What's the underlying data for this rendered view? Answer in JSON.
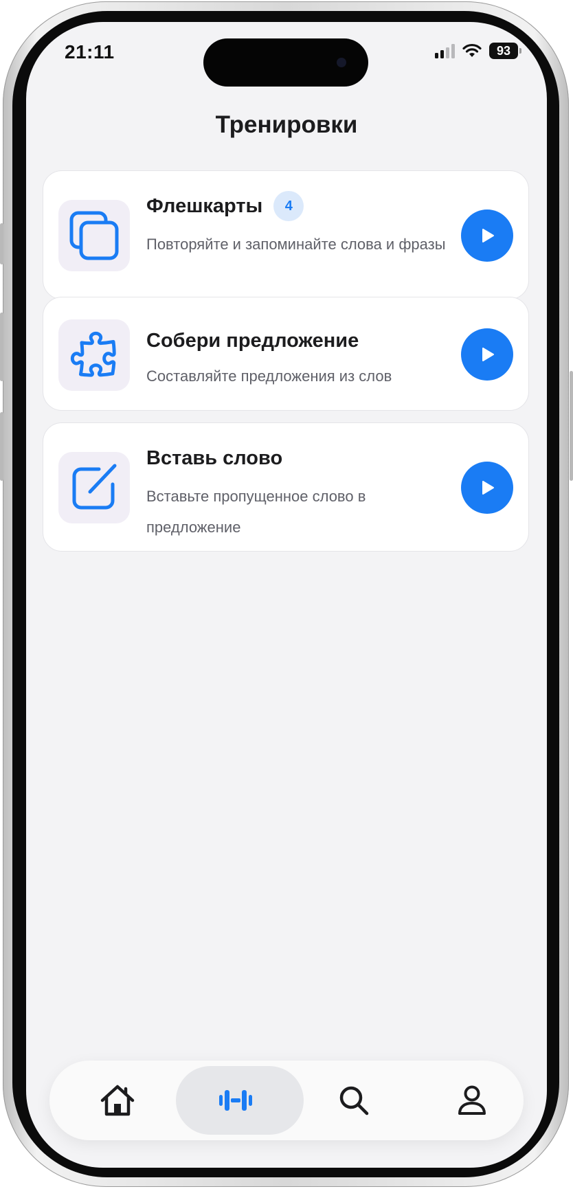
{
  "status_bar": {
    "time": "21:11",
    "battery": "93",
    "icons": [
      "cellular-signal-icon",
      "wifi-icon",
      "battery-icon"
    ]
  },
  "header": {
    "title": "Тренировки"
  },
  "trainings": [
    {
      "title": "Флешкарты",
      "badge": "4",
      "description": "Повторяйте и запоминайте слова и фразы",
      "icon": "cards-stack-icon"
    },
    {
      "title": "Собери предложение",
      "description": "Составляйте предложения из слов",
      "icon": "puzzle-icon"
    },
    {
      "title": "Вставь слово",
      "description": "Вставьте пропущенное слово в предложение",
      "icon": "edit-square-icon"
    }
  ],
  "tabbar": {
    "items": [
      {
        "name": "home",
        "icon": "home-icon",
        "active": false
      },
      {
        "name": "trainings",
        "icon": "dumbbell-icon",
        "active": true
      },
      {
        "name": "search",
        "icon": "search-icon",
        "active": false
      },
      {
        "name": "profile",
        "icon": "person-icon",
        "active": false
      }
    ]
  },
  "colors": {
    "accent": "#1a7cf4",
    "background": "#f3f3f5",
    "card": "#ffffff",
    "icon_tile": "#f1eef6",
    "badge_bg": "#dbe9fb",
    "title_text": "#1c1c1e",
    "secondary_text": "#5f6068",
    "tab_active_bg": "#e6e7ea"
  }
}
